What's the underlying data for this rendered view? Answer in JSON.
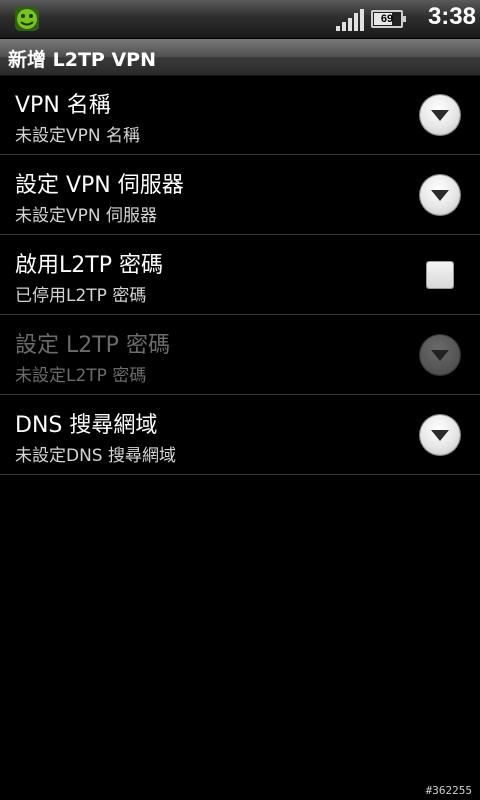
{
  "status_bar": {
    "time": "3:38",
    "battery_level": "69",
    "battery_percent": 69,
    "app_icon": "android-app-icon",
    "signal_icon": "signal-strength-icon"
  },
  "title_bar": {
    "title": "新增 L2TP VPN"
  },
  "settings": [
    {
      "id": "vpn-name",
      "label": "VPN 名稱",
      "summary": "未設定VPN 名稱",
      "control": "dropdown",
      "enabled": true
    },
    {
      "id": "vpn-server",
      "label": "設定 VPN 伺服器",
      "summary": "未設定VPN 伺服器",
      "control": "dropdown",
      "enabled": true
    },
    {
      "id": "enable-l2tp-secret",
      "label": "啟用L2TP 密碼",
      "summary": "已停用L2TP 密碼",
      "control": "checkbox",
      "checked": false,
      "enabled": true
    },
    {
      "id": "set-l2tp-secret",
      "label": "設定 L2TP 密碼",
      "summary": "未設定L2TP 密碼",
      "control": "dropdown",
      "enabled": false
    },
    {
      "id": "dns-search-domains",
      "label": "DNS 搜尋網域",
      "summary": "未設定DNS 搜尋網域",
      "control": "dropdown",
      "enabled": true
    }
  ],
  "watermark": "#362255"
}
